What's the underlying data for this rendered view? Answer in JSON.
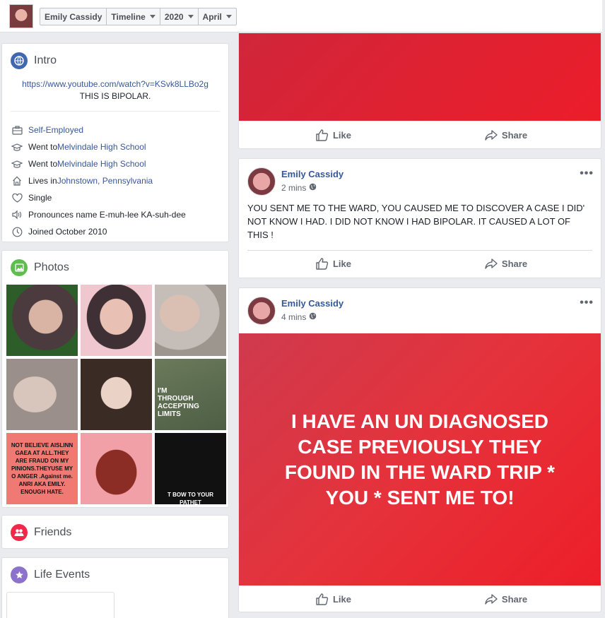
{
  "timeline_selector": {
    "name": "Emily Cassidy",
    "view": "Timeline",
    "year": "2020",
    "month": "April"
  },
  "intro": {
    "title": "Intro",
    "link": "https://www.youtube.com/watch?v=KSvk8LLBo2g",
    "bio": "THIS IS BIPOLAR.",
    "items": [
      {
        "icon": "briefcase-icon",
        "prefix": "",
        "link": "Self-Employed"
      },
      {
        "icon": "graduation-cap-icon",
        "prefix": "Went to ",
        "link": "Melvindale High School"
      },
      {
        "icon": "graduation-cap-icon",
        "prefix": "Went to ",
        "link": "Melvindale High School"
      },
      {
        "icon": "home-icon",
        "prefix": "Lives in ",
        "link": "Johnstown, Pennsylvania"
      },
      {
        "icon": "heart-icon",
        "prefix": "Single",
        "link": ""
      },
      {
        "icon": "speaker-icon",
        "prefix": "Pronounces name E-muh-lee KA-suh-dee",
        "link": ""
      },
      {
        "icon": "clock-icon",
        "prefix": "Joined October 2010",
        "link": ""
      }
    ]
  },
  "photos": {
    "title": "Photos",
    "tiles": [
      {
        "text": ""
      },
      {
        "text": ""
      },
      {
        "text": ""
      },
      {
        "text": ""
      },
      {
        "text": ""
      },
      {
        "text": "I'M THROUGH ACCEPTING LIMITS"
      },
      {
        "text": "NOT BELIEVE AISLINN GAEA AT ALL.THEY ARE FRAUD ON MY PINIONS.THEYUSE MY O ANGER .Against me. ANRI AKA EMILY. ENOUGH HATE."
      },
      {
        "text": ""
      },
      {
        "text": "T BOW TO YOUR PATHET"
      }
    ]
  },
  "friends": {
    "title": "Friends"
  },
  "life_events": {
    "title": "Life Events"
  },
  "actions": {
    "like": "Like",
    "share": "Share"
  },
  "posts": [
    {
      "author": "Emily Cassidy",
      "time": "2 mins",
      "text": "YOU SENT ME TO THE WARD, YOU CAUSED ME TO DISCOVER A CASE I DID' NOT KNOW I HAD. I DID NOT KNOW I HAD BIPOLAR. IT CAUSED A LOT OF THIS !"
    },
    {
      "author": "Emily Cassidy",
      "time": "4 mins",
      "image_text": "I HAVE AN UN DIAGNOSED CASE PREVIOUSLY THEY FOUND IN THE WARD TRIP * YOU * SENT ME TO!"
    }
  ],
  "colors": {
    "link": "#385898",
    "post_background_red": "#e5323b",
    "intro_icon": "#4267b2",
    "photos_icon": "#44bec7",
    "friends_icon": "#f02849",
    "life_events_icon": "#8c72cb"
  }
}
